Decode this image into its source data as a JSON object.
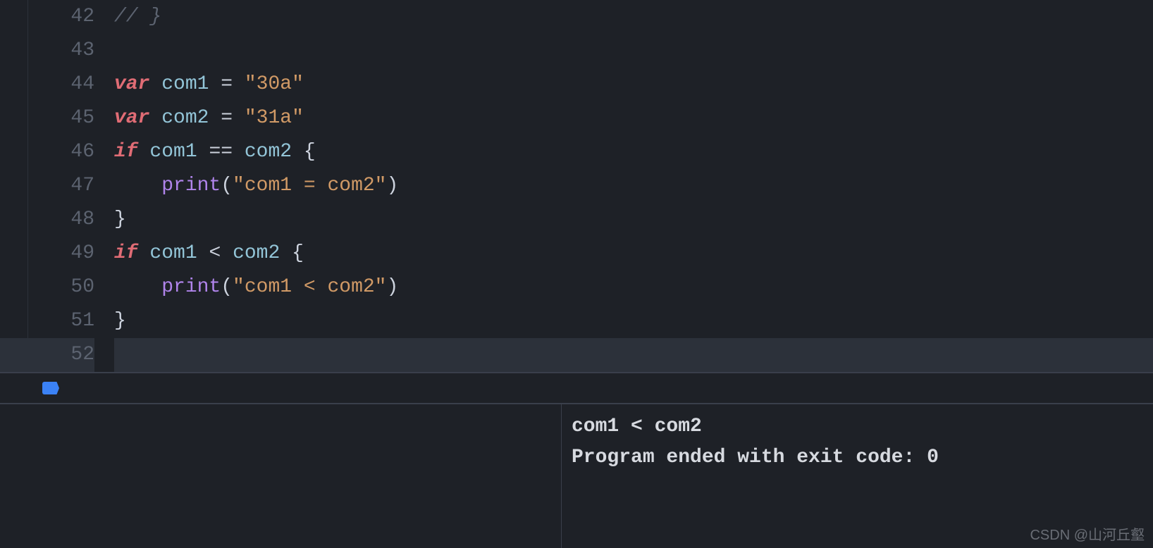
{
  "editor": {
    "lines": [
      {
        "num": "42",
        "tokens": [
          {
            "cls": "comment",
            "t": "// }"
          }
        ]
      },
      {
        "num": "43",
        "tokens": []
      },
      {
        "num": "44",
        "tokens": [
          {
            "cls": "kw",
            "t": "var"
          },
          {
            "cls": "op",
            "t": " "
          },
          {
            "cls": "var",
            "t": "com1"
          },
          {
            "cls": "op",
            "t": " = "
          },
          {
            "cls": "str",
            "t": "\"30a\""
          }
        ]
      },
      {
        "num": "45",
        "tokens": [
          {
            "cls": "kw",
            "t": "var"
          },
          {
            "cls": "op",
            "t": " "
          },
          {
            "cls": "var",
            "t": "com2"
          },
          {
            "cls": "op",
            "t": " = "
          },
          {
            "cls": "str",
            "t": "\"31a\""
          }
        ]
      },
      {
        "num": "46",
        "tokens": [
          {
            "cls": "kw",
            "t": "if"
          },
          {
            "cls": "op",
            "t": " "
          },
          {
            "cls": "var",
            "t": "com1"
          },
          {
            "cls": "op",
            "t": " == "
          },
          {
            "cls": "var",
            "t": "com2"
          },
          {
            "cls": "op",
            "t": " "
          },
          {
            "cls": "brace",
            "t": "{"
          }
        ]
      },
      {
        "num": "47",
        "tokens": [
          {
            "cls": "op",
            "t": "    "
          },
          {
            "cls": "func",
            "t": "print"
          },
          {
            "cls": "brace",
            "t": "("
          },
          {
            "cls": "str",
            "t": "\"com1 = com2\""
          },
          {
            "cls": "brace",
            "t": ")"
          }
        ]
      },
      {
        "num": "48",
        "tokens": [
          {
            "cls": "brace",
            "t": "}"
          }
        ]
      },
      {
        "num": "49",
        "tokens": [
          {
            "cls": "kw",
            "t": "if"
          },
          {
            "cls": "op",
            "t": " "
          },
          {
            "cls": "var",
            "t": "com1"
          },
          {
            "cls": "op",
            "t": " < "
          },
          {
            "cls": "var",
            "t": "com2"
          },
          {
            "cls": "op",
            "t": " "
          },
          {
            "cls": "brace",
            "t": "{"
          }
        ]
      },
      {
        "num": "50",
        "tokens": [
          {
            "cls": "op",
            "t": "    "
          },
          {
            "cls": "func",
            "t": "print"
          },
          {
            "cls": "brace",
            "t": "("
          },
          {
            "cls": "str",
            "t": "\"com1 < com2\""
          },
          {
            "cls": "brace",
            "t": ")"
          }
        ]
      },
      {
        "num": "51",
        "tokens": [
          {
            "cls": "brace",
            "t": "}"
          }
        ]
      },
      {
        "num": "52",
        "tokens": [],
        "current": true
      }
    ]
  },
  "console": {
    "output_line1": "com1 < com2",
    "output_line2": "Program ended with exit code: 0"
  },
  "watermark": "CSDN @山河丘壑"
}
